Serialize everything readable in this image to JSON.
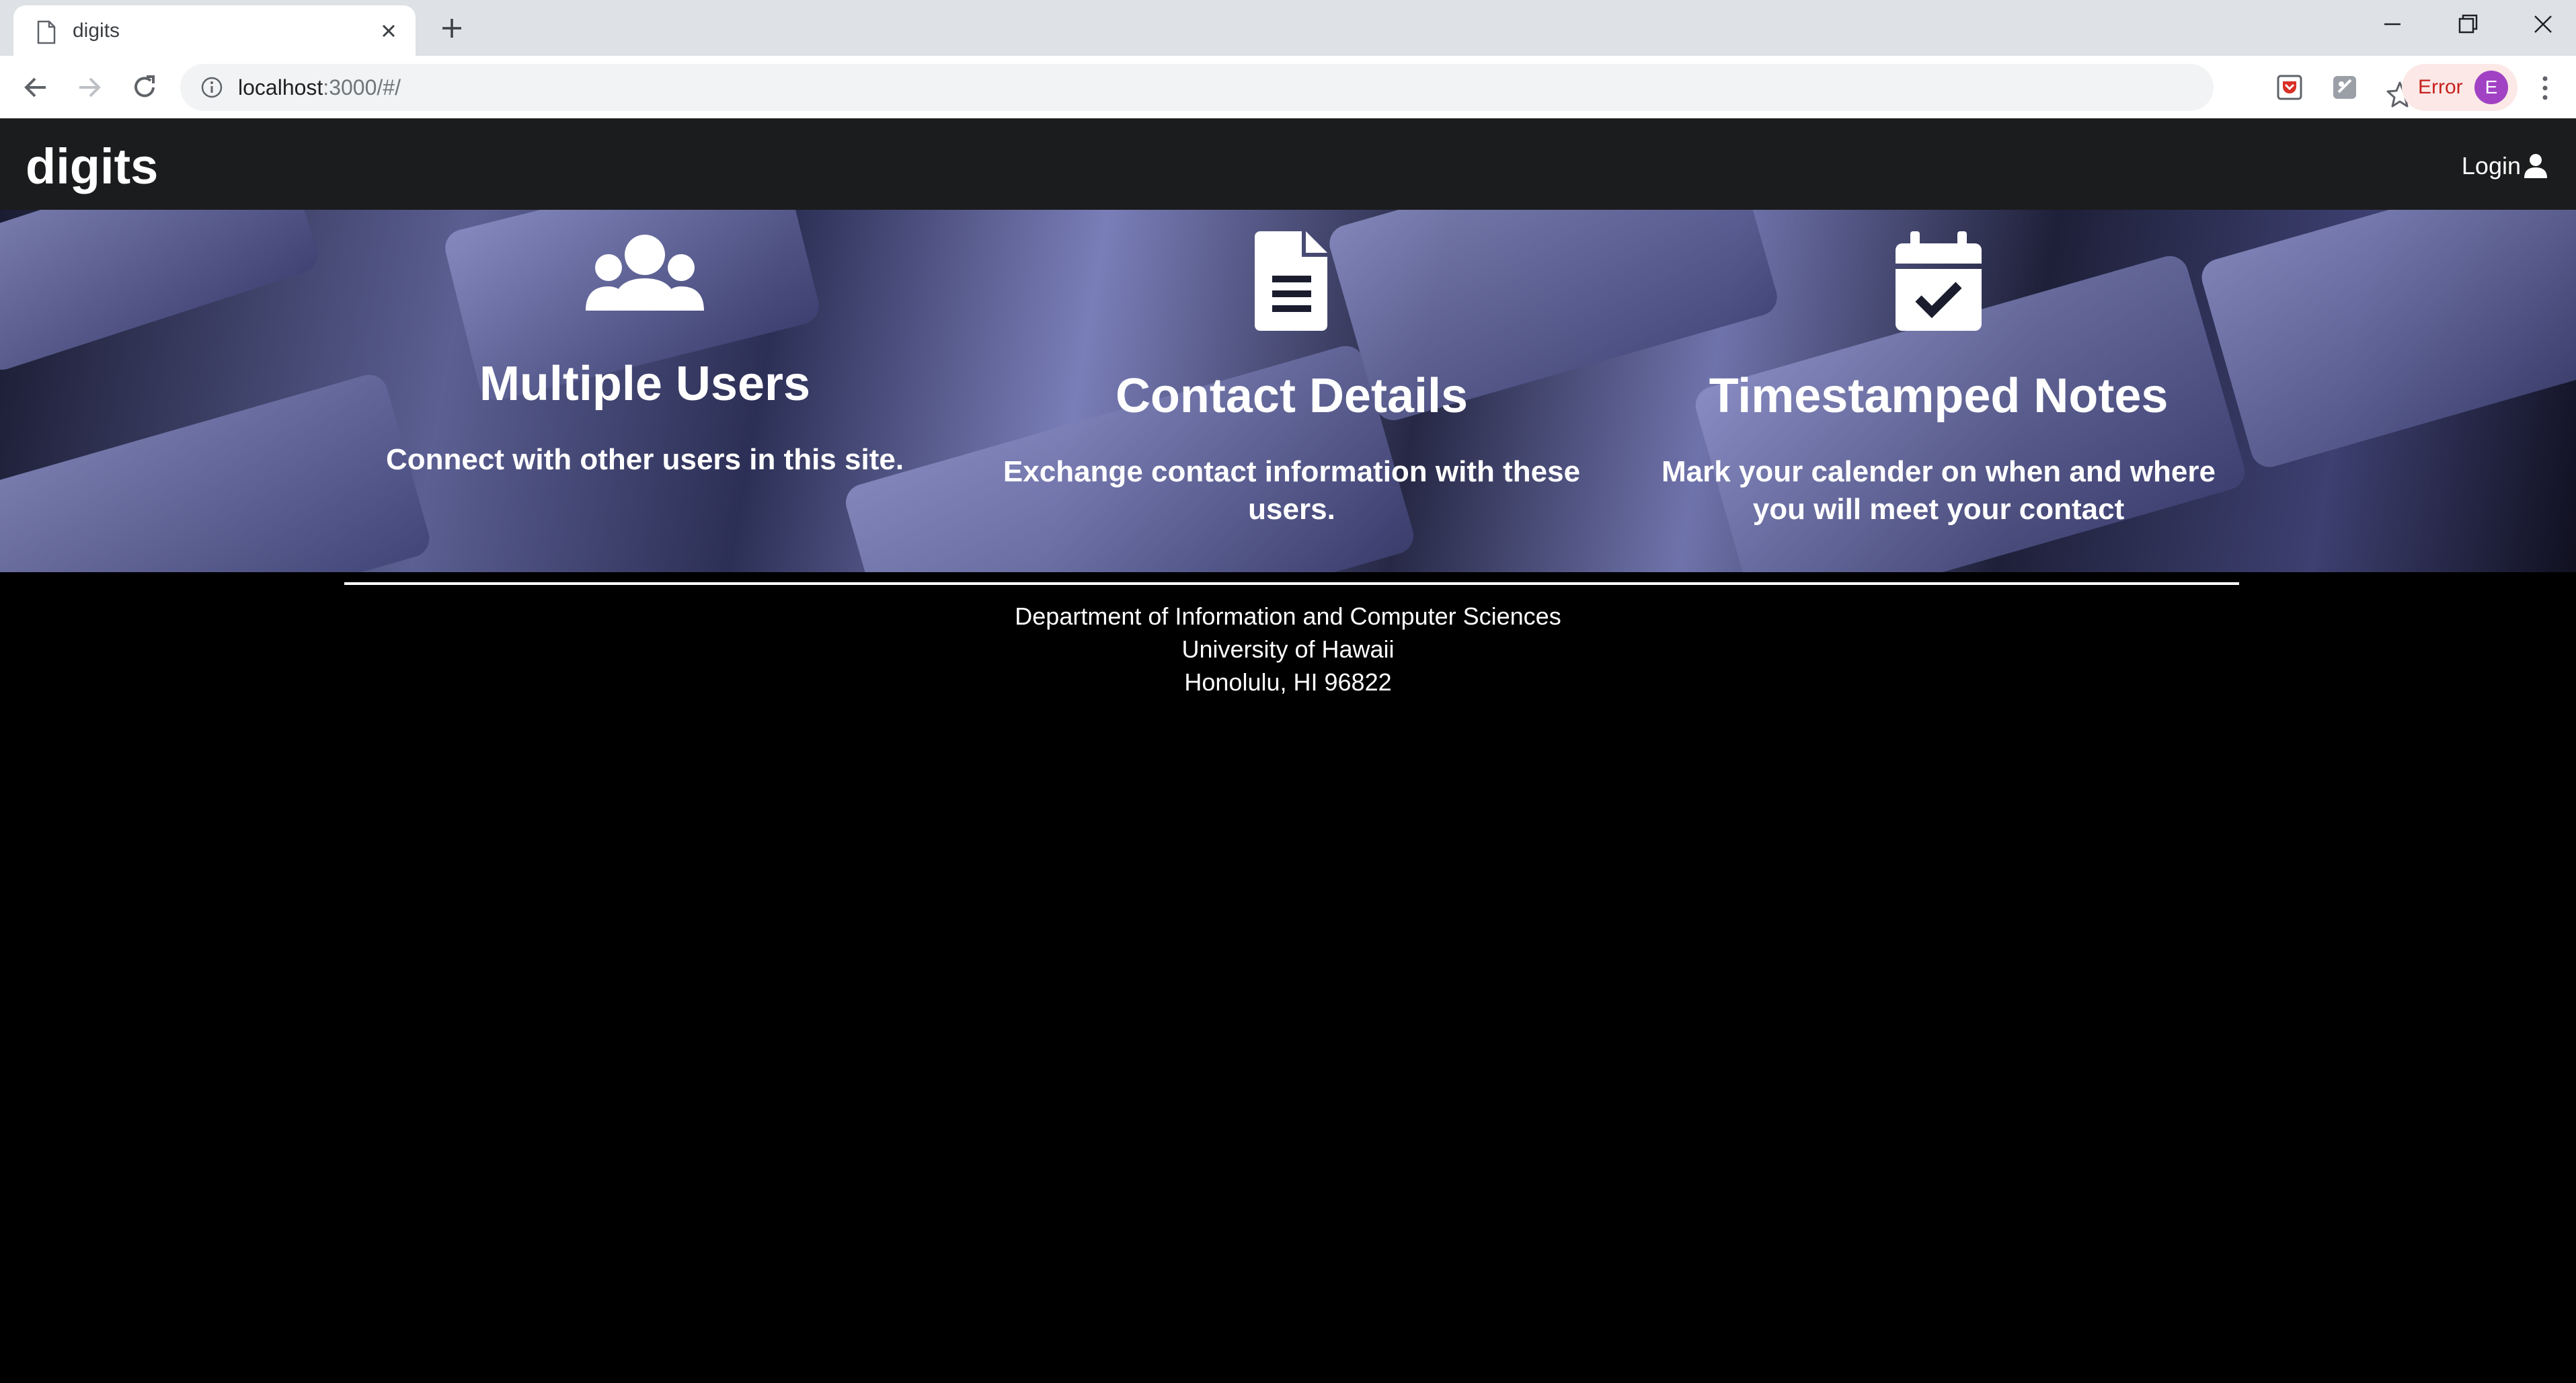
{
  "browser": {
    "tab_title": "digits",
    "url_host": "localhost",
    "url_rest": ":3000/#/",
    "profile_status": "Error",
    "profile_initial": "E"
  },
  "navbar": {
    "brand": "digits",
    "login_label": "Login"
  },
  "features": [
    {
      "icon": "users-icon",
      "title": "Multiple Users",
      "text": "Connect with other users in this site."
    },
    {
      "icon": "file-text-icon",
      "title": "Contact Details",
      "text": "Exchange contact information with these users."
    },
    {
      "icon": "calendar-check-icon",
      "title": "Timestamped Notes",
      "text": "Mark your calender on when and where you will meet your contact"
    }
  ],
  "footer": {
    "line1": "Department of Information and Computer Sciences",
    "line2": "University of Hawaii",
    "line3": "Honolulu, HI 96822"
  }
}
